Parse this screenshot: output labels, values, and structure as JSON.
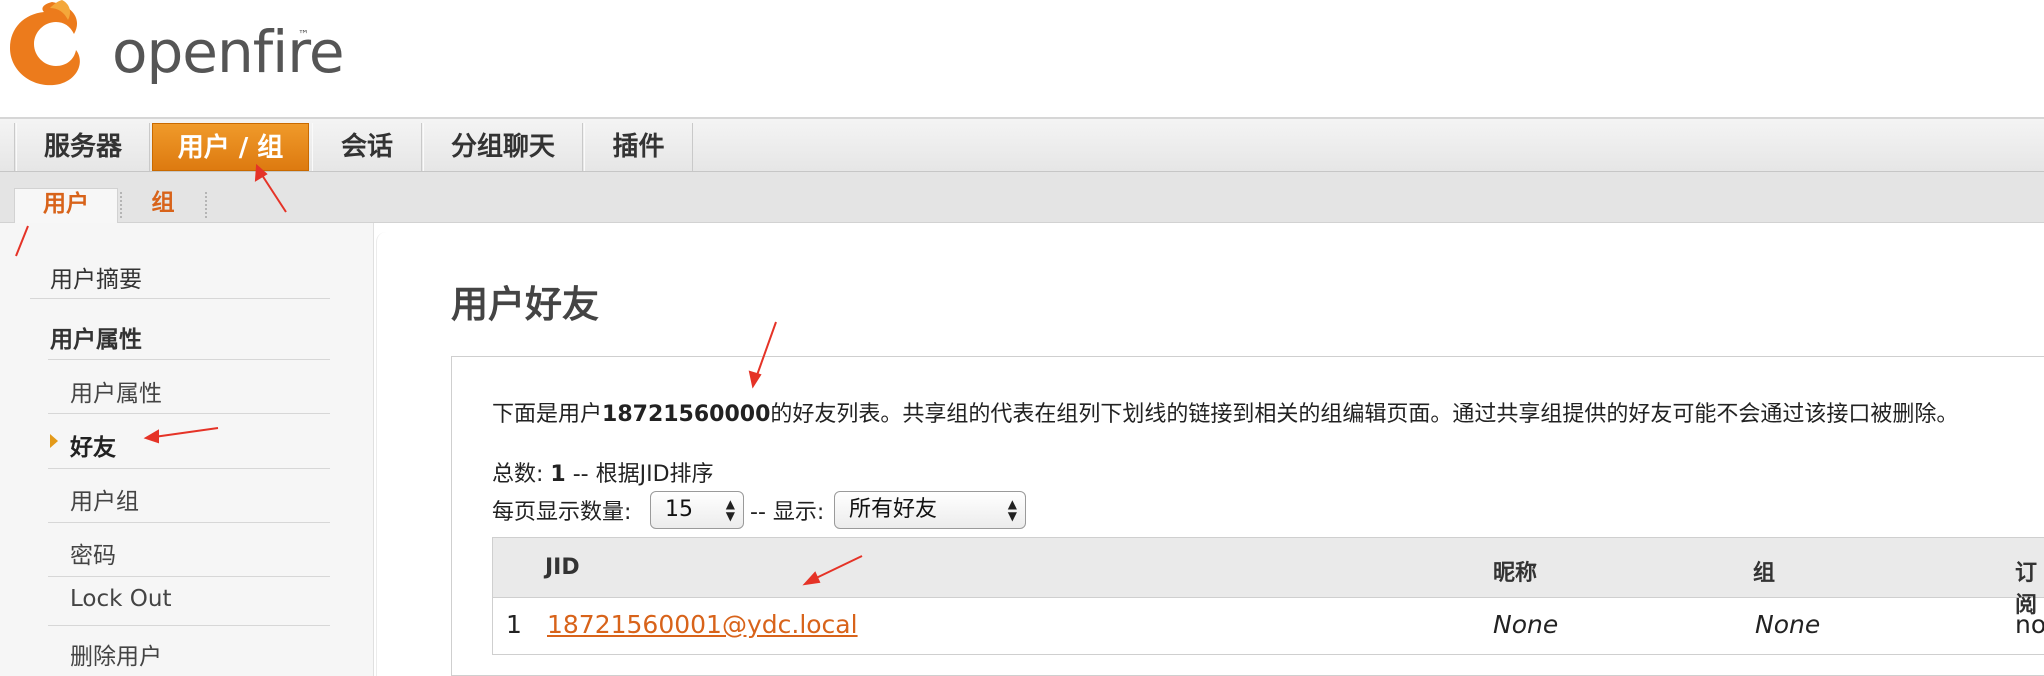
{
  "brand": {
    "name": "openfire",
    "tm": "™",
    "accent": "#e8821a",
    "link_color": "#d8631a"
  },
  "main_nav": {
    "tabs": [
      {
        "label": "服务器",
        "active": false
      },
      {
        "label": "用户 / 组",
        "active": true
      },
      {
        "label": "会话",
        "active": false
      },
      {
        "label": "分组聊天",
        "active": false
      },
      {
        "label": "插件",
        "active": false
      }
    ]
  },
  "sub_nav": {
    "tabs": [
      {
        "label": "用户",
        "active": true
      },
      {
        "label": "组",
        "active": false
      }
    ]
  },
  "sidebar": {
    "items": [
      {
        "label": "用户摘要",
        "level": 0
      },
      {
        "label": "用户属性",
        "level": 0
      },
      {
        "label": "用户属性",
        "level": 1
      },
      {
        "label": "好友",
        "level": 1,
        "selected": true
      },
      {
        "label": "用户组",
        "level": 1
      },
      {
        "label": "密码",
        "level": 1
      },
      {
        "label": "Lock Out",
        "level": 1
      },
      {
        "label": "删除用户",
        "level": 1
      }
    ]
  },
  "main": {
    "title": "用户好友",
    "description_prefix": "下面是用户",
    "username": "18721560000",
    "description_suffix": "的好友列表。共享组的代表在组列下划线的链接到相关的组编辑页面。通过共享组提供的好友可能不会通过该接口被删除。",
    "total_label": "总数:",
    "total_value": "1",
    "sort_text": "-- 根据JID排序",
    "per_page_label": "每页显示数量:",
    "per_page_value": "15",
    "display_label": "-- 显示:",
    "display_value": "所有好友",
    "table": {
      "headers": [
        "JID",
        "昵称",
        "组",
        "订阅"
      ],
      "rows": [
        {
          "index": "1",
          "jid": "18721560001@ydc.local",
          "nickname": "None",
          "group": "None",
          "subscription": "none"
        }
      ]
    }
  }
}
